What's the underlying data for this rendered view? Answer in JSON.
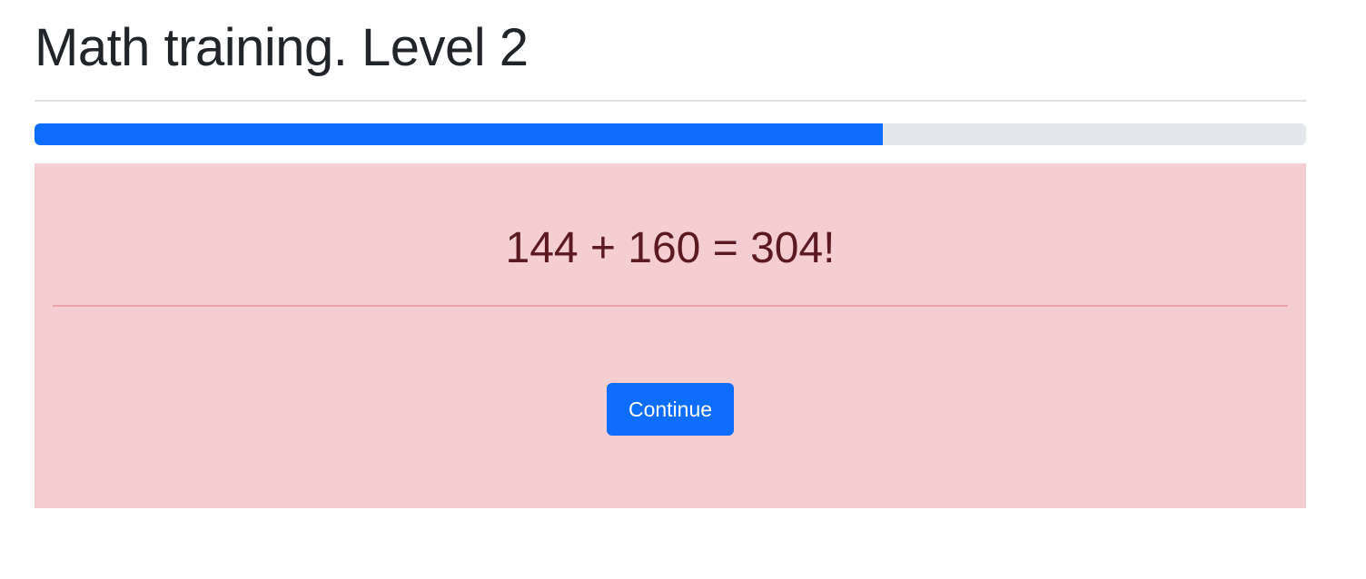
{
  "header": {
    "title": "Math training. Level 2"
  },
  "progress": {
    "value_percent": 66.7,
    "fill_color": "#0d6efd",
    "track_color": "#e4e7eb"
  },
  "result": {
    "text": "144 + 160 = 304!",
    "background_color": "#f5ced2",
    "text_color": "#5c1a20"
  },
  "actions": {
    "continue_label": "Continue"
  }
}
